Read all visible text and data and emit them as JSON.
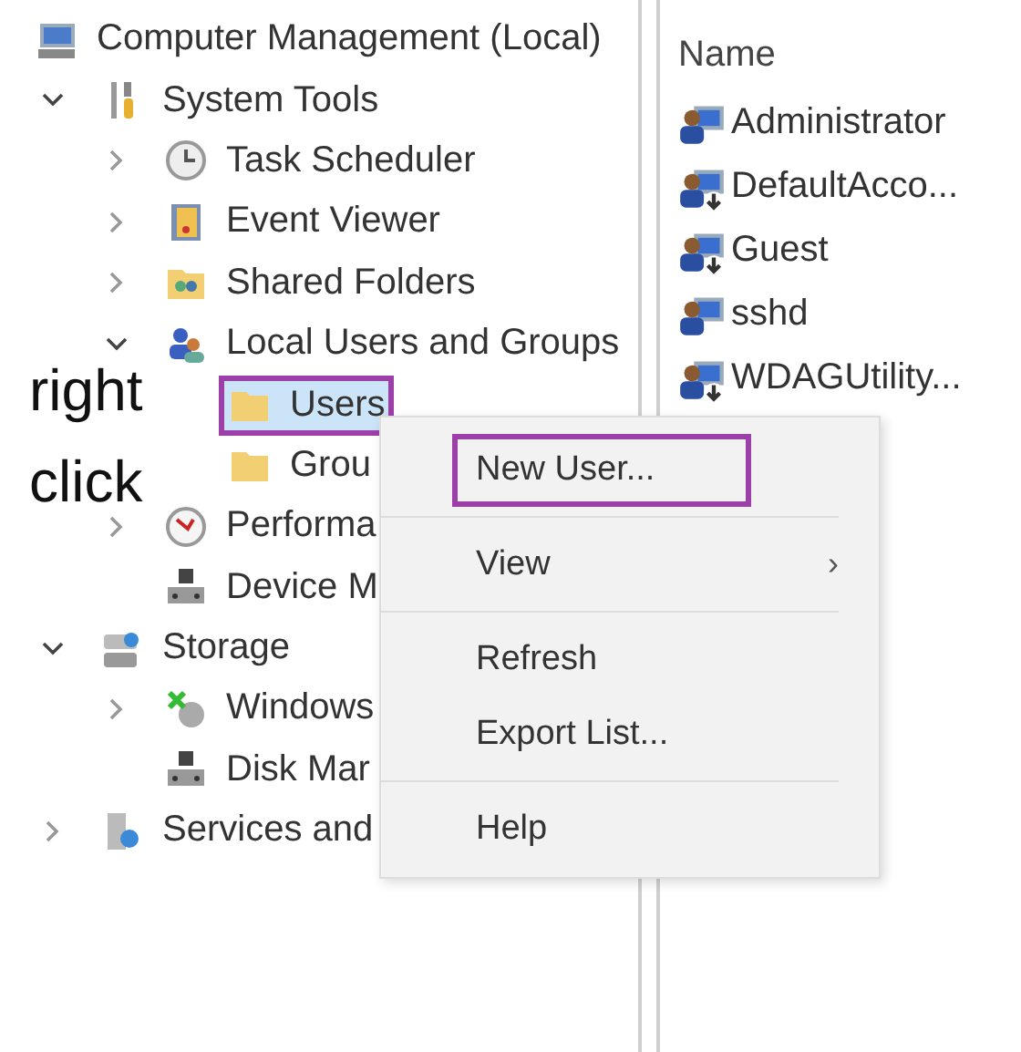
{
  "tree": [
    {
      "label": "Computer Management (Local)",
      "kind": "computer",
      "children": [
        {
          "label": "System Tools",
          "kind": "tools",
          "expanded": true,
          "children": [
            {
              "label": "Task Scheduler",
              "kind": "clock",
              "expanded": false
            },
            {
              "label": "Event Viewer",
              "kind": "book",
              "expanded": false
            },
            {
              "label": "Shared Folders",
              "kind": "shared",
              "expanded": false
            },
            {
              "label": "Local Users and Groups",
              "kind": "users",
              "expanded": true,
              "children": [
                {
                  "label": "Users",
                  "kind": "folder",
                  "selected": true,
                  "highlighted": true
                },
                {
                  "label": "Grou",
                  "kind": "folder",
                  "selected": false,
                  "highlighted": false
                }
              ]
            },
            {
              "label": "Performa",
              "kind": "gauge",
              "expanded": false
            },
            {
              "label": "Device M",
              "kind": "device"
            }
          ]
        },
        {
          "label": "Storage",
          "kind": "storage",
          "expanded": true,
          "children": [
            {
              "label": "Windows",
              "kind": "backup",
              "expanded": false
            },
            {
              "label": "Disk Mar",
              "kind": "device"
            }
          ]
        },
        {
          "label": "Services and",
          "kind": "services",
          "expanded": false
        }
      ]
    }
  ],
  "list": {
    "column": "Name",
    "rows": [
      {
        "name": "Administrator",
        "kind": "admin"
      },
      {
        "name": "DefaultAcco...",
        "kind": "disabled"
      },
      {
        "name": "Guest",
        "kind": "disabled"
      },
      {
        "name": "sshd",
        "kind": "admin"
      },
      {
        "name": "WDAGUtility...",
        "kind": "disabled"
      }
    ]
  },
  "context_menu": [
    {
      "kind": "item",
      "label": "New User...",
      "highlighted": true
    },
    {
      "kind": "separator"
    },
    {
      "kind": "item",
      "label": "View",
      "has_submenu": true,
      "submenu_arrow": "›"
    },
    {
      "kind": "separator"
    },
    {
      "kind": "item",
      "label": "Refresh"
    },
    {
      "kind": "item",
      "label": "Export List..."
    },
    {
      "kind": "separator"
    },
    {
      "kind": "item",
      "label": "Help"
    }
  ],
  "annotations": [
    "right",
    "click"
  ]
}
